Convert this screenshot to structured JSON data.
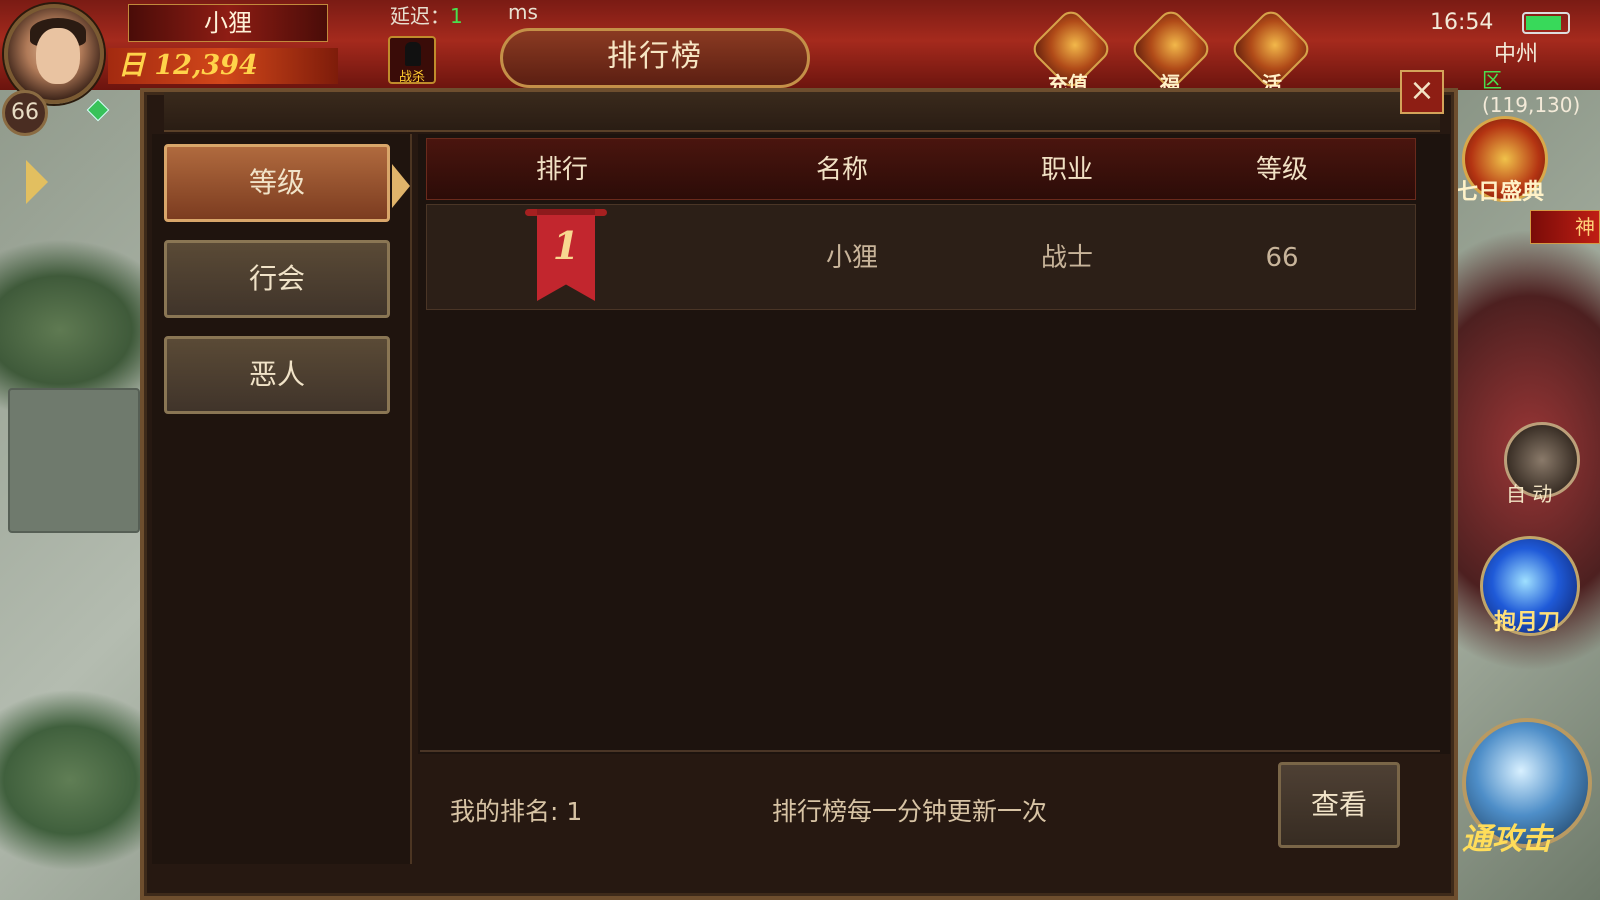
{
  "hud": {
    "player_name": "小狸",
    "player_level": "66",
    "gold_display": "日 12,394",
    "latency_label": "延迟：",
    "latency_value": "1",
    "latency_unit": "ms",
    "pk_mode": "战杀",
    "top_icons": [
      "充值",
      "福",
      "活"
    ],
    "clock": "16:54",
    "battery_level": 0.88,
    "map_name": "中州",
    "map_zone": "区",
    "map_coords": "(119,130)",
    "right_buttons": {
      "seven_day": "七日盛典",
      "side_banner": "神",
      "auto": "自 动",
      "skill_moon": "抱月刀",
      "skill_attack": "通攻击"
    }
  },
  "dialog": {
    "title": "排行榜",
    "close_icon": "×",
    "tabs": [
      {
        "label": "等级",
        "active": true
      },
      {
        "label": "行会",
        "active": false
      },
      {
        "label": "恶人",
        "active": false
      }
    ],
    "columns": [
      "排行",
      "名称",
      "职业",
      "等级"
    ],
    "rows": [
      {
        "rank": "1",
        "name": "小狸",
        "class": "战士",
        "level": "66"
      }
    ],
    "my_rank": "我的排名: 1",
    "update_note": "排行榜每一分钟更新一次",
    "view_button": "查看"
  },
  "colors": {
    "accent_red": "#a52a1d",
    "gold": "#ffd34a",
    "panel": "#261811",
    "active_tab": "#b06a3e",
    "green": "#49e04e"
  }
}
